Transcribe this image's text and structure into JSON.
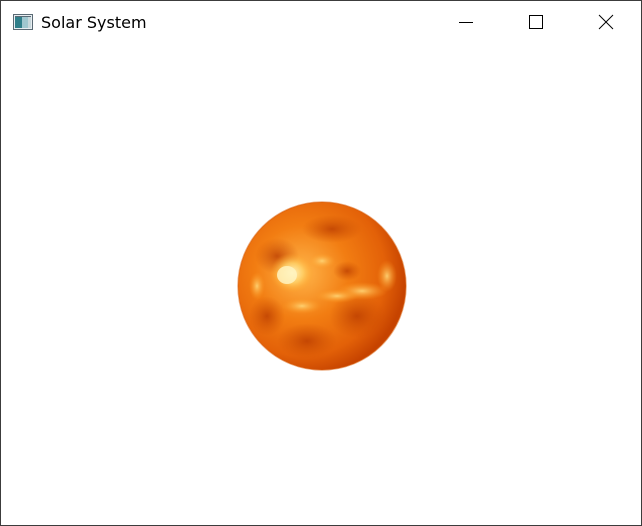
{
  "window": {
    "title": "Solar System",
    "app_icon": "window-app-icon",
    "controls": {
      "minimize_icon": "minimize-icon",
      "maximize_icon": "maximize-icon",
      "close_icon": "close-icon"
    }
  },
  "scene": {
    "object": "sun",
    "colors": {
      "core": "#ffe9a0",
      "mid": "#f07a10",
      "edge": "#c64300"
    }
  }
}
